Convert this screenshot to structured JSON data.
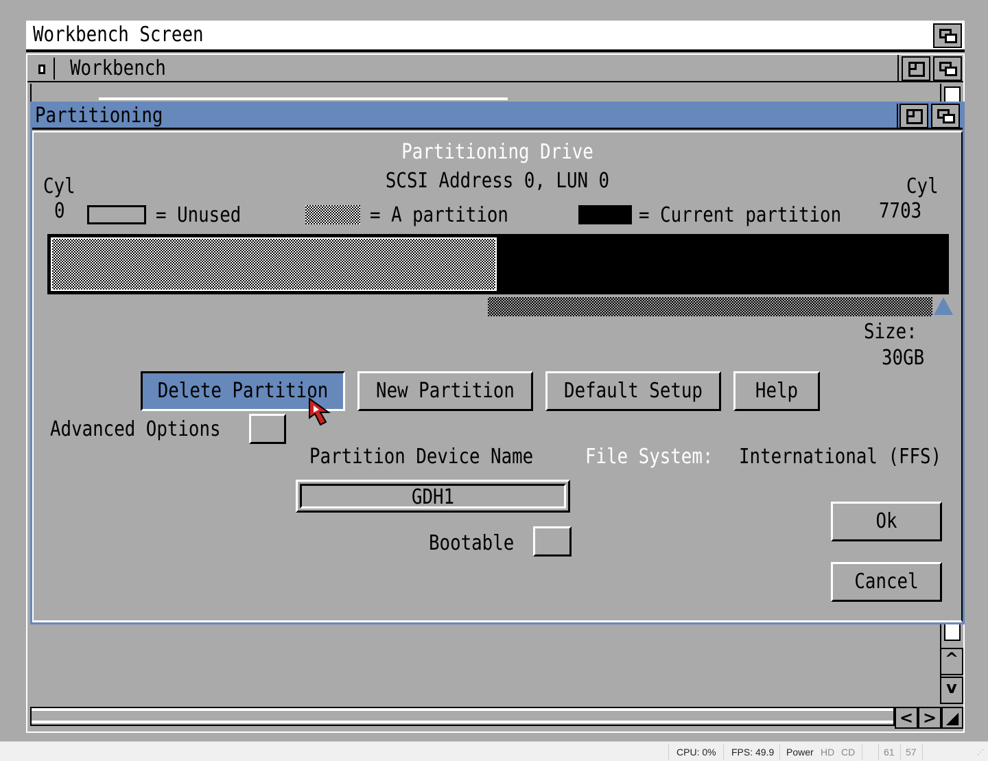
{
  "screen": {
    "title": "Workbench Screen"
  },
  "workbench_window": {
    "title": "Workbench"
  },
  "partition_window": {
    "title": "Partitioning",
    "heading": "Partitioning Drive",
    "subheading": "SCSI Address 0, LUN 0",
    "cyl_label": "Cyl",
    "cyl_start": "0",
    "cyl_end": "7703",
    "legend": {
      "unused": "= Unused",
      "partition": "= A partition",
      "current": "= Current partition"
    },
    "partition_bar": {
      "partition_fraction": 0.5,
      "current_fraction": 0.5
    },
    "size_label": "Size:",
    "size_value": "30GB",
    "buttons": {
      "delete": "Delete Partition",
      "new": "New Partition",
      "default": "Default Setup",
      "help": "Help",
      "ok": "Ok",
      "cancel": "Cancel"
    },
    "advanced_options_label": "Advanced Options",
    "device_name_label": "Partition Device Name",
    "device_name_value": "GDH1",
    "file_system_label": "File System:",
    "file_system_value": "International (FFS)",
    "bootable_label": "Bootable"
  },
  "status_bar": {
    "cpu": "CPU: 0%",
    "fps": "FPS: 49.9",
    "power": "Power",
    "hd": "HD",
    "cd": "CD",
    "n1": "61",
    "n2": "57"
  },
  "colors": {
    "accent": "#6688bb",
    "background": "#aaaaaa"
  },
  "icons": [
    "depth-icon",
    "zoom-icon",
    "close-icon",
    "arrow-up-icon",
    "arrow-down-icon",
    "arrow-left-icon",
    "arrow-right-icon",
    "resize-icon",
    "mouse-pointer-icon"
  ]
}
